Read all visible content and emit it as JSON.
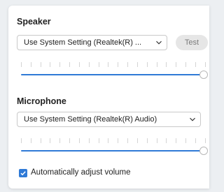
{
  "speaker": {
    "title": "Speaker",
    "device_select": "Use System Setting (Realtek(R) ...",
    "test_label": "Test",
    "volume_percent": 100
  },
  "microphone": {
    "title": "Microphone",
    "device_select": "Use System Setting (Realtek(R) Audio)",
    "volume_percent": 100
  },
  "auto_adjust": {
    "label": "Automatically adjust volume",
    "checked": true
  },
  "colors": {
    "accent": "#2f7ad6",
    "panel": "#ffffff",
    "background": "#eceff2"
  },
  "icons": [
    "chevron-down-icon",
    "check-icon"
  ]
}
